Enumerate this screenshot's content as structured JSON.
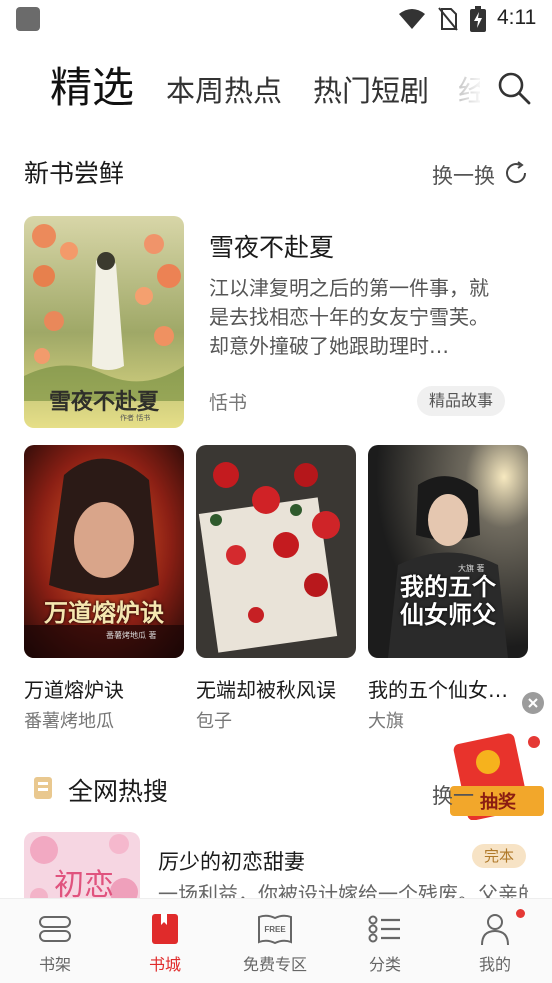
{
  "status_bar": {
    "time": "4:11"
  },
  "top_tabs": {
    "active": "精选",
    "items": [
      "本周热点",
      "热门短剧",
      "经"
    ]
  },
  "new_books": {
    "title": "新书尝鲜",
    "refresh_label": "换一换",
    "featured": {
      "title": "雪夜不赴夏",
      "description": "江以津复明之后的第一件事，就是去找相恋十年的女友宁雪芙。却意外撞破了她跟助理时…",
      "author": "恬书",
      "tag": "精品故事",
      "cover_text": "雪夜不赴夏",
      "cover_author_text": "作者 恬书"
    },
    "books": [
      {
        "title": "万道熔炉诀",
        "author": "番薯烤地瓜",
        "cover_text": "万道熔炉诀",
        "cover_sub": "番薯烤地瓜 著"
      },
      {
        "title": "无端却被秋风误",
        "author": "包子"
      },
      {
        "title": "我的五个仙女…",
        "author": "大旗",
        "cover_text_1": "我的五个",
        "cover_text_2": "仙女师父",
        "cover_sub": "大旗 著"
      }
    ]
  },
  "hot_search": {
    "title": "全网热搜",
    "refresh_label": "换一",
    "book": {
      "title": "厉少的初恋甜妻",
      "badge": "完本",
      "description": "一场利益，你被设计嫁给一个残废。父亲的怀",
      "cover_text": "初恋"
    }
  },
  "floating": {
    "redpacket_label": "抽奖"
  },
  "bottom_nav": {
    "items": [
      {
        "label": "书架",
        "icon": "bookshelf-icon"
      },
      {
        "label": "书城",
        "icon": "bookstore-icon"
      },
      {
        "label": "免费专区",
        "icon": "free-book-icon"
      },
      {
        "label": "分类",
        "icon": "category-icon"
      },
      {
        "label": "我的",
        "icon": "profile-icon"
      }
    ],
    "active_index": 1
  },
  "colors": {
    "accent": "#e02b2b",
    "badge_bg": "#f7e3c5"
  }
}
